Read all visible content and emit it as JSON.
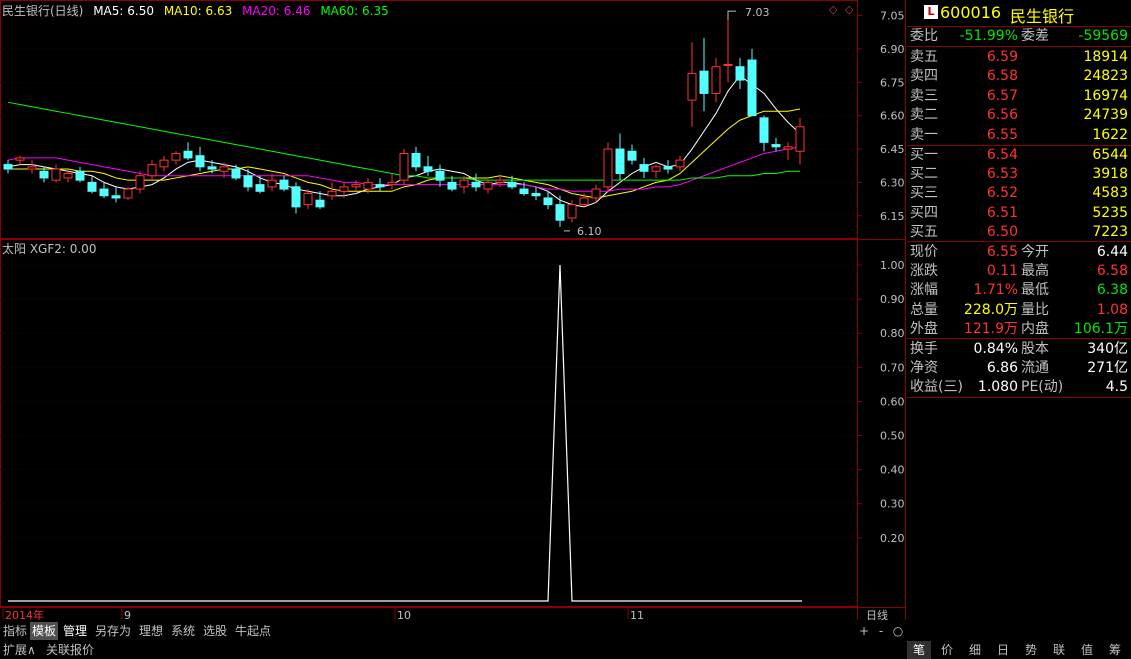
{
  "window": {
    "stock_title": "民生银行(日线)"
  },
  "ma_legend": [
    {
      "label": "MA5: 6.50",
      "color": "#ffffff"
    },
    {
      "label": "MA10: 6.63",
      "color": "#ffff00"
    },
    {
      "label": "MA20: 6.46",
      "color": "#ff00ff"
    },
    {
      "label": "MA60: 6.35",
      "color": "#00ff00"
    }
  ],
  "indicator_legend": "太阳 XGF2: 0.00",
  "price_axis": [
    "7.05",
    "6.90",
    "6.75",
    "6.60",
    "6.45",
    "6.30",
    "6.15"
  ],
  "indicator_axis": [
    "1.00",
    "0.90",
    "0.80",
    "0.70",
    "0.60",
    "0.50",
    "0.40",
    "0.30",
    "0.20"
  ],
  "date_axis": [
    "2014年",
    "9",
    "10",
    "11",
    "日线"
  ],
  "annotations": {
    "high": "7.03",
    "low": "6.10"
  },
  "chart_data": {
    "type": "candlestick",
    "price_range": [
      6.05,
      7.12
    ],
    "candles": [
      [
        6.38,
        6.4,
        6.34,
        6.36
      ],
      [
        6.4,
        6.42,
        6.38,
        6.41
      ],
      [
        6.36,
        6.4,
        6.34,
        6.37
      ],
      [
        6.35,
        6.37,
        6.3,
        6.32
      ],
      [
        6.31,
        6.38,
        6.3,
        6.36
      ],
      [
        6.32,
        6.36,
        6.3,
        6.34
      ],
      [
        6.35,
        6.37,
        6.3,
        6.31
      ],
      [
        6.3,
        6.33,
        6.25,
        6.26
      ],
      [
        6.27,
        6.3,
        6.23,
        6.24
      ],
      [
        6.24,
        6.28,
        6.21,
        6.23
      ],
      [
        6.23,
        6.28,
        6.22,
        6.27
      ],
      [
        6.27,
        6.35,
        6.25,
        6.33
      ],
      [
        6.33,
        6.4,
        6.31,
        6.38
      ],
      [
        6.37,
        6.42,
        6.35,
        6.4
      ],
      [
        6.4,
        6.44,
        6.38,
        6.43
      ],
      [
        6.44,
        6.48,
        6.4,
        6.41
      ],
      [
        6.42,
        6.46,
        6.35,
        6.37
      ],
      [
        6.37,
        6.4,
        6.34,
        6.36
      ],
      [
        6.35,
        6.39,
        6.32,
        6.37
      ],
      [
        6.36,
        6.38,
        6.31,
        6.32
      ],
      [
        6.33,
        6.36,
        6.26,
        6.28
      ],
      [
        6.29,
        6.33,
        6.25,
        6.26
      ],
      [
        6.28,
        6.34,
        6.26,
        6.31
      ],
      [
        6.31,
        6.33,
        6.26,
        6.27
      ],
      [
        6.28,
        6.3,
        6.16,
        6.19
      ],
      [
        6.2,
        6.27,
        6.18,
        6.25
      ],
      [
        6.22,
        6.26,
        6.18,
        6.19
      ],
      [
        6.24,
        6.3,
        6.22,
        6.26
      ],
      [
        6.26,
        6.3,
        6.23,
        6.28
      ],
      [
        6.28,
        6.31,
        6.26,
        6.29
      ],
      [
        6.27,
        6.32,
        6.25,
        6.3
      ],
      [
        6.29,
        6.32,
        6.26,
        6.28
      ],
      [
        6.29,
        6.34,
        6.27,
        6.3
      ],
      [
        6.31,
        6.45,
        6.29,
        6.43
      ],
      [
        6.43,
        6.46,
        6.35,
        6.37
      ],
      [
        6.37,
        6.42,
        6.33,
        6.35
      ],
      [
        6.35,
        6.38,
        6.28,
        6.31
      ],
      [
        6.3,
        6.33,
        6.26,
        6.27
      ],
      [
        6.28,
        6.33,
        6.25,
        6.31
      ],
      [
        6.3,
        6.34,
        6.26,
        6.28
      ],
      [
        6.27,
        6.31,
        6.25,
        6.3
      ],
      [
        6.3,
        6.33,
        6.28,
        6.31
      ],
      [
        6.3,
        6.33,
        6.27,
        6.28
      ],
      [
        6.27,
        6.3,
        6.24,
        6.25
      ],
      [
        6.25,
        6.28,
        6.22,
        6.24
      ],
      [
        6.23,
        6.26,
        6.18,
        6.2
      ],
      [
        6.2,
        6.24,
        6.1,
        6.13
      ],
      [
        6.14,
        6.22,
        6.12,
        6.2
      ],
      [
        6.2,
        6.25,
        6.19,
        6.23
      ],
      [
        6.23,
        6.29,
        6.21,
        6.27
      ],
      [
        6.28,
        6.48,
        6.26,
        6.45
      ],
      [
        6.45,
        6.52,
        6.31,
        6.34
      ],
      [
        6.44,
        6.47,
        6.38,
        6.4
      ],
      [
        6.38,
        6.41,
        6.32,
        6.35
      ],
      [
        6.35,
        6.38,
        6.32,
        6.37
      ],
      [
        6.37,
        6.4,
        6.34,
        6.36
      ],
      [
        6.37,
        6.42,
        6.35,
        6.4
      ],
      [
        6.67,
        6.93,
        6.55,
        6.79
      ],
      [
        6.8,
        6.95,
        6.62,
        6.7
      ],
      [
        6.7,
        6.86,
        6.66,
        6.82
      ],
      [
        6.83,
        7.03,
        6.75,
        6.83
      ],
      [
        6.82,
        6.86,
        6.72,
        6.76
      ],
      [
        6.85,
        6.9,
        6.6,
        6.6
      ],
      [
        6.59,
        6.6,
        6.44,
        6.48
      ],
      [
        6.47,
        6.5,
        6.44,
        6.46
      ],
      [
        6.45,
        6.48,
        6.4,
        6.46
      ],
      [
        6.44,
        6.59,
        6.38,
        6.55
      ]
    ],
    "ma_series": [
      {
        "name": "MA5",
        "color": "#ffffff",
        "values": [
          6.37,
          6.38,
          6.38,
          6.37,
          6.36,
          6.35,
          6.34,
          6.33,
          6.3,
          6.28,
          6.27,
          6.28,
          6.29,
          6.32,
          6.36,
          6.39,
          6.4,
          6.39,
          6.38,
          6.37,
          6.35,
          6.32,
          6.3,
          6.29,
          6.27,
          6.26,
          6.25,
          6.24,
          6.24,
          6.25,
          6.27,
          6.28,
          6.29,
          6.32,
          6.33,
          6.35,
          6.36,
          6.35,
          6.34,
          6.31,
          6.29,
          6.3,
          6.3,
          6.29,
          6.28,
          6.26,
          6.22,
          6.2,
          6.19,
          6.21,
          6.26,
          6.3,
          6.34,
          6.37,
          6.39,
          6.37,
          6.38,
          6.45,
          6.53,
          6.61,
          6.71,
          6.78,
          6.74,
          6.7,
          6.63,
          6.57,
          6.52
        ]
      },
      {
        "name": "MA10",
        "color": "#ffff00",
        "values": [
          6.36,
          6.36,
          6.36,
          6.36,
          6.36,
          6.36,
          6.35,
          6.35,
          6.34,
          6.32,
          6.31,
          6.31,
          6.31,
          6.31,
          6.32,
          6.33,
          6.34,
          6.35,
          6.36,
          6.36,
          6.37,
          6.36,
          6.35,
          6.34,
          6.32,
          6.3,
          6.29,
          6.27,
          6.26,
          6.26,
          6.26,
          6.26,
          6.26,
          6.28,
          6.29,
          6.31,
          6.32,
          6.32,
          6.32,
          6.32,
          6.32,
          6.33,
          6.32,
          6.31,
          6.3,
          6.29,
          6.27,
          6.25,
          6.24,
          6.23,
          6.24,
          6.25,
          6.26,
          6.28,
          6.3,
          6.31,
          6.34,
          6.39,
          6.44,
          6.49,
          6.54,
          6.58,
          6.6,
          6.62,
          6.62,
          6.62,
          6.63
        ]
      },
      {
        "name": "MA20",
        "color": "#ff00ff",
        "values": [
          6.4,
          6.41,
          6.41,
          6.41,
          6.41,
          6.4,
          6.39,
          6.38,
          6.37,
          6.36,
          6.35,
          6.34,
          6.33,
          6.33,
          6.33,
          6.33,
          6.33,
          6.33,
          6.33,
          6.33,
          6.33,
          6.33,
          6.33,
          6.33,
          6.33,
          6.33,
          6.32,
          6.31,
          6.3,
          6.3,
          6.29,
          6.29,
          6.29,
          6.29,
          6.29,
          6.29,
          6.29,
          6.29,
          6.29,
          6.29,
          6.29,
          6.29,
          6.29,
          6.29,
          6.28,
          6.27,
          6.27,
          6.26,
          6.26,
          6.26,
          6.26,
          6.27,
          6.27,
          6.27,
          6.28,
          6.28,
          6.29,
          6.31,
          6.33,
          6.35,
          6.37,
          6.39,
          6.41,
          6.43,
          6.44,
          6.45,
          6.46
        ]
      },
      {
        "name": "MA60",
        "color": "#00ff00",
        "values": [
          6.66,
          6.65,
          6.64,
          6.63,
          6.62,
          6.61,
          6.6,
          6.59,
          6.58,
          6.57,
          6.56,
          6.55,
          6.54,
          6.53,
          6.52,
          6.51,
          6.5,
          6.49,
          6.48,
          6.47,
          6.46,
          6.45,
          6.44,
          6.43,
          6.42,
          6.41,
          6.4,
          6.39,
          6.38,
          6.37,
          6.36,
          6.35,
          6.34,
          6.33,
          6.33,
          6.32,
          6.32,
          6.32,
          6.32,
          6.31,
          6.31,
          6.31,
          6.31,
          6.31,
          6.31,
          6.31,
          6.31,
          6.31,
          6.31,
          6.31,
          6.31,
          6.31,
          6.31,
          6.31,
          6.31,
          6.31,
          6.31,
          6.32,
          6.32,
          6.32,
          6.33,
          6.33,
          6.33,
          6.34,
          6.34,
          6.35,
          6.35
        ]
      }
    ],
    "indicator": {
      "name": "XGF2",
      "range": [
        0,
        1.05
      ],
      "peak_index": 46,
      "peak_value": 1.0
    }
  },
  "quote": {
    "code": "600016",
    "name": "民生银行",
    "logo": "L",
    "weibi": {
      "label": "委比",
      "value": "-51.99%",
      "label2": "委差",
      "value2": "-59569"
    },
    "asks": [
      {
        "label": "卖五",
        "price": "6.59",
        "vol": "18914"
      },
      {
        "label": "卖四",
        "price": "6.58",
        "vol": "24823"
      },
      {
        "label": "卖三",
        "price": "6.57",
        "vol": "16974"
      },
      {
        "label": "卖二",
        "price": "6.56",
        "vol": "24739"
      },
      {
        "label": "卖一",
        "price": "6.55",
        "vol": "1622"
      }
    ],
    "bids": [
      {
        "label": "买一",
        "price": "6.54",
        "vol": "6544"
      },
      {
        "label": "买二",
        "price": "6.53",
        "vol": "3918"
      },
      {
        "label": "买三",
        "price": "6.52",
        "vol": "4583"
      },
      {
        "label": "买四",
        "price": "6.51",
        "vol": "5235"
      },
      {
        "label": "买五",
        "price": "6.50",
        "vol": "7223"
      }
    ],
    "stats1": [
      {
        "l1": "现价",
        "v1": "6.55",
        "c1": "red",
        "l2": "今开",
        "v2": "6.44",
        "c2": "wht"
      },
      {
        "l1": "涨跌",
        "v1": "0.11",
        "c1": "red",
        "l2": "最高",
        "v2": "6.58",
        "c2": "red"
      },
      {
        "l1": "涨幅",
        "v1": "1.71%",
        "c1": "red",
        "l2": "最低",
        "v2": "6.38",
        "c2": "grn"
      },
      {
        "l1": "总量",
        "v1": "228.0万",
        "c1": "yel",
        "l2": "量比",
        "v2": "1.08",
        "c2": "red"
      },
      {
        "l1": "外盘",
        "v1": "121.9万",
        "c1": "red",
        "l2": "内盘",
        "v2": "106.1万",
        "c2": "grn"
      }
    ],
    "stats2": [
      {
        "l1": "换手",
        "v1": "0.84%",
        "l2": "股本",
        "v2": "340亿"
      },
      {
        "l1": "净资",
        "v1": "6.86",
        "l2": "流通",
        "v2": "271亿"
      },
      {
        "l1": "收益(三)",
        "v1": "1.080",
        "l2": "PE(动)",
        "v2": "4.5"
      }
    ]
  },
  "tabs": [
    "指标",
    "模板",
    "管理",
    "另存为",
    "理想",
    "系统",
    "选股",
    "牛起点"
  ],
  "bottom": [
    "扩展∧",
    "关联报价"
  ],
  "zoom": [
    "+",
    "-",
    "○"
  ],
  "right_tabs": [
    "笔",
    "价",
    "细",
    "日",
    "势",
    "联",
    "值",
    "筹"
  ]
}
